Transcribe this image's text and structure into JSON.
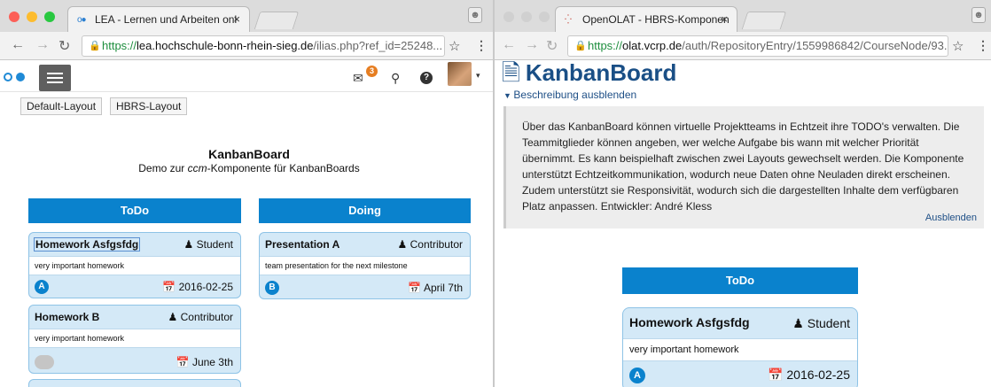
{
  "left_window": {
    "tab_title": "LEA - Lernen und Arbeiten onl",
    "url_https": "https://",
    "url_host": "lea.hochschule-bonn-rhein-sieg.de",
    "url_path": "/ilias.php?ref_id=25248...",
    "notification_count": "3",
    "layout_buttons": [
      "Default-Layout",
      "HBRS-Layout"
    ],
    "board_title": "KanbanBoard",
    "board_subtitle_pre": "Demo zur ",
    "board_subtitle_em": "ccm",
    "board_subtitle_post": "-Komponente für KanbanBoards",
    "columns": [
      "ToDo",
      "Doing"
    ],
    "cards": [
      {
        "title": "Homework Asfgsfdg",
        "user": "Student",
        "desc": "very important homework",
        "prio": "A",
        "due": "2016-02-25"
      },
      {
        "title": "Homework B",
        "user": "Contributor",
        "desc": "very important homework",
        "prio": "",
        "due": "June 3th"
      },
      {
        "title": "Presentation A",
        "user": "Contributor",
        "desc": "team presentation for the next milestone",
        "prio": "B",
        "due": "April 7th"
      }
    ]
  },
  "right_window": {
    "tab_title": "OpenOLAT - HBRS-Komponen",
    "url_https": "https://",
    "url_host": "olat.vcrp.de",
    "url_path": "/auth/RepositoryEntry/1559986842/CourseNode/93...",
    "page_title": "KanbanBoard",
    "toggle_label": "Beschreibung ausblenden",
    "description": "Über das KanbanBoard können virtuelle Projektteams in Echtzeit ihre TODO's verwalten. Die Teammitglieder können angeben, wer welche Aufgabe bis wann mit welcher Priorität übernimmt. Es kann beispielhaft zwischen zwei Layouts gewechselt werden. Die Komponente unterstützt Echtzeitkommunikation, wodurch neue Daten ohne Neuladen direkt erscheinen. Zudem unterstützt sie Responsivität, wodurch sich die dargestellten Inhalte dem verfügbaren Platz anpassen. Entwickler: André Kless",
    "hide_link": "Ausblenden",
    "column": "ToDo",
    "card": {
      "title": "Homework Asfgsfdg",
      "user": "Student",
      "desc": "very important homework",
      "prio": "A",
      "due": "2016-02-25"
    }
  },
  "colors": {
    "accent": "#0a82cd",
    "card_bg": "#d4e9f7",
    "link": "#1e4f86"
  }
}
